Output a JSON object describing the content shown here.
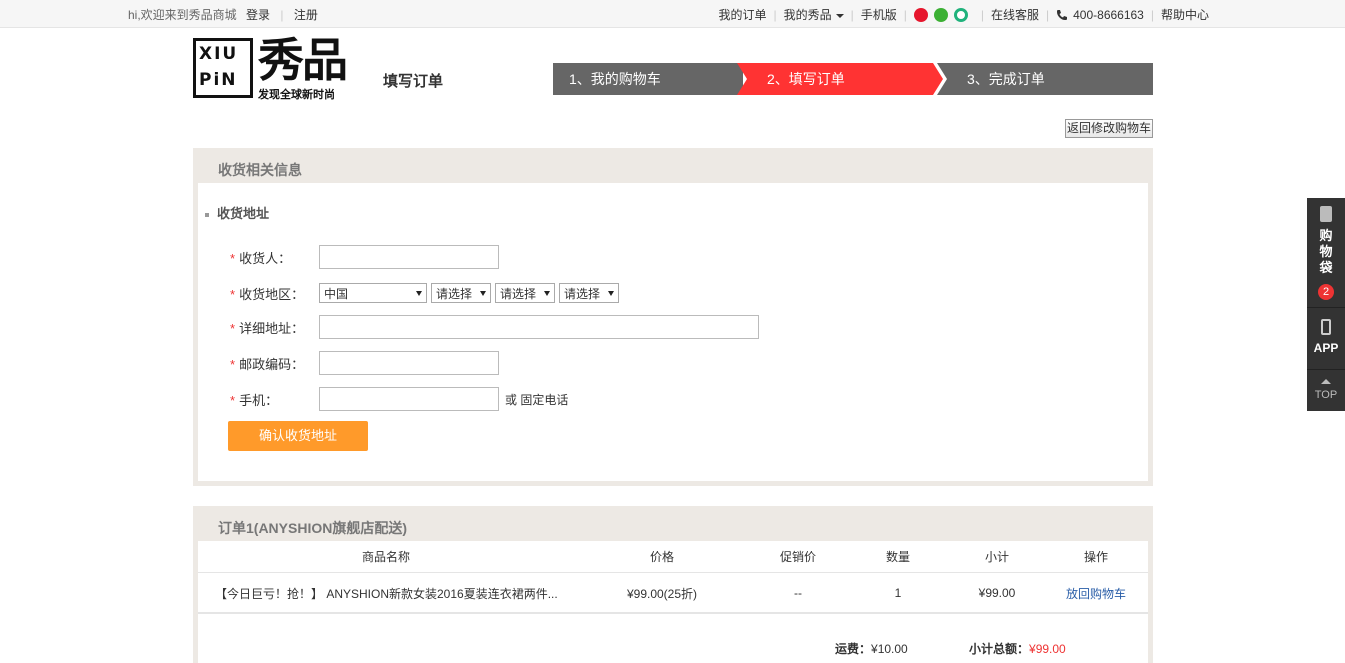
{
  "topbar": {
    "welcome": "hi,欢迎来到秀品商城",
    "login": "登录",
    "register": "注册",
    "my_orders": "我的订单",
    "my_xiupin": "我的秀品",
    "mobile": "手机版",
    "online_service": "在线客服",
    "phone": "400-8666163",
    "help": "帮助中心"
  },
  "header": {
    "logo_latin_1": "XIU",
    "logo_latin_2": "PiN",
    "logo_cn": "秀品",
    "slogan": "发现全球新时尚",
    "page_title": "填写订单",
    "steps": [
      "1、我的购物车",
      "2、填写订单",
      "3、完成订单"
    ],
    "back_button": "返回修改购物车"
  },
  "address_panel": {
    "title": "收货相关信息",
    "subtitle": "收货地址",
    "labels": {
      "receiver": "收货人：",
      "region": "收货地区：",
      "detail": "详细地址：",
      "postcode": "邮政编码：",
      "mobile": "手机："
    },
    "region_selects": [
      "中国",
      "请选择",
      "请选择",
      "请选择"
    ],
    "or_phone": "或 固定电话",
    "confirm_button": "确认收货地址"
  },
  "order_panel": {
    "title": "订单1(ANYSHION旗舰店配送)",
    "columns": [
      "商品名称",
      "价格",
      "促销价",
      "数量",
      "小计",
      "操作"
    ],
    "rows": [
      {
        "name": "【今日巨亏！抢！】 ANYSHION新款女装2016夏装连衣裙两件...",
        "price": "¥99.00(25折)",
        "promo": "--",
        "qty": "1",
        "subtotal": "¥99.00",
        "action": "放回购物车"
      }
    ],
    "shipping_label": "运费：",
    "shipping_value": "¥10.00",
    "total_label": "小计总额：",
    "total_value": "¥99.00"
  },
  "sidebar": {
    "cart_label": "购物袋",
    "cart_count": "2",
    "app_label": "APP",
    "top_label": "TOP"
  },
  "colors": {
    "accent_red": "#ff3333",
    "step_gray": "#666666",
    "confirm_orange": "#ff9a2a",
    "panel_bg": "#ede9e4"
  }
}
